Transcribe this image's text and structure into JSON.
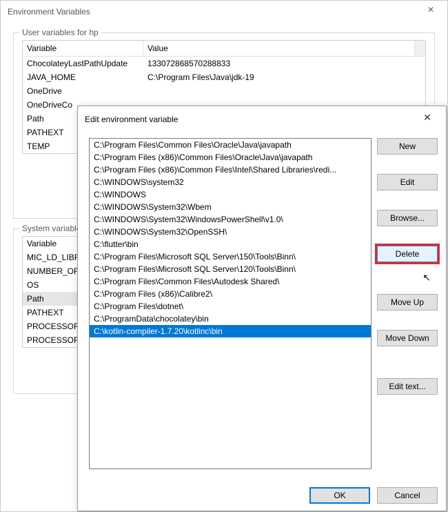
{
  "parent": {
    "title": "Environment Variables",
    "close_glyph": "✕",
    "user_section_label": "User variables for hp",
    "system_section_label": "System variables",
    "col_variable": "Variable",
    "col_value": "Value",
    "user_vars": [
      {
        "name": "ChocolateyLastPathUpdate",
        "value": "133072868570288833"
      },
      {
        "name": "JAVA_HOME",
        "value": "C:\\Program Files\\Java\\jdk-19"
      },
      {
        "name": "OneDrive",
        "value": ""
      },
      {
        "name": "OneDriveCo",
        "value": ""
      },
      {
        "name": "Path",
        "value": ""
      },
      {
        "name": "PATHEXT",
        "value": ""
      },
      {
        "name": "TEMP",
        "value": ""
      }
    ],
    "system_vars": [
      {
        "name": "Variable",
        "value": ""
      },
      {
        "name": "MIC_LD_LIBR",
        "value": ""
      },
      {
        "name": "NUMBER_OF",
        "value": ""
      },
      {
        "name": "OS",
        "value": ""
      },
      {
        "name": "Path",
        "value": "",
        "sel": true
      },
      {
        "name": "PATHEXT",
        "value": ""
      },
      {
        "name": "PROCESSOR",
        "value": ""
      },
      {
        "name": "PROCESSOR",
        "value": ""
      }
    ]
  },
  "modal": {
    "title": "Edit environment variable",
    "close_glyph": "✕",
    "items": [
      "C:\\Program Files\\Common Files\\Oracle\\Java\\javapath",
      "C:\\Program Files (x86)\\Common Files\\Oracle\\Java\\javapath",
      "C:\\Program Files (x86)\\Common Files\\Intel\\Shared Libraries\\redi...",
      "C:\\WINDOWS\\system32",
      "C:\\WINDOWS",
      "C:\\WINDOWS\\System32\\Wbem",
      "C:\\WINDOWS\\System32\\WindowsPowerShell\\v1.0\\",
      "C:\\WINDOWS\\System32\\OpenSSH\\",
      "C:\\flutter\\bin",
      "C:\\Program Files\\Microsoft SQL Server\\150\\Tools\\Binn\\",
      "C:\\Program Files\\Microsoft SQL Server\\120\\Tools\\Binn\\",
      "C:\\Program Files\\Common Files\\Autodesk Shared\\",
      "C:\\Program Files (x86)\\Calibre2\\",
      "C:\\Program Files\\dotnet\\",
      "C:\\ProgramData\\chocolatey\\bin",
      "C:\\kotlin-compiler-1.7.20\\kotlinc\\bin"
    ],
    "selected_index": 15,
    "buttons": {
      "new": "New",
      "edit": "Edit",
      "browse": "Browse...",
      "delete": "Delete",
      "move_up": "Move Up",
      "move_down": "Move Down",
      "edit_text": "Edit text...",
      "ok": "OK",
      "cancel": "Cancel"
    }
  }
}
